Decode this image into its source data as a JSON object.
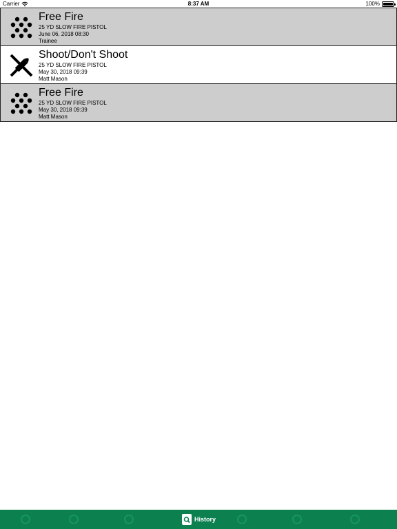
{
  "status_bar": {
    "carrier": "Carrier",
    "time": "8:37 AM",
    "battery": "100%",
    "battery_level": 1.0
  },
  "history": {
    "items": [
      {
        "icon": "shot-group-icon",
        "title": "Free Fire",
        "course": "25 YD SLOW FIRE PISTOL",
        "datetime": "June 06, 2018  08:30",
        "shooter": "Trainee"
      },
      {
        "icon": "crossed-ammo-icon",
        "title": "Shoot/Don't Shoot",
        "course": "25 YD SLOW FIRE PISTOL",
        "datetime": "May 30, 2018  09:39",
        "shooter": "Matt Mason"
      },
      {
        "icon": "shot-group-icon",
        "title": "Free Fire",
        "course": "25 YD SLOW FIRE PISTOL",
        "datetime": "May 30, 2018  09:39",
        "shooter": "Matt Mason"
      }
    ]
  },
  "tab_bar": {
    "active_label": "History",
    "colors": {
      "background": "#0d8050",
      "active_text": "#ffffff"
    }
  }
}
